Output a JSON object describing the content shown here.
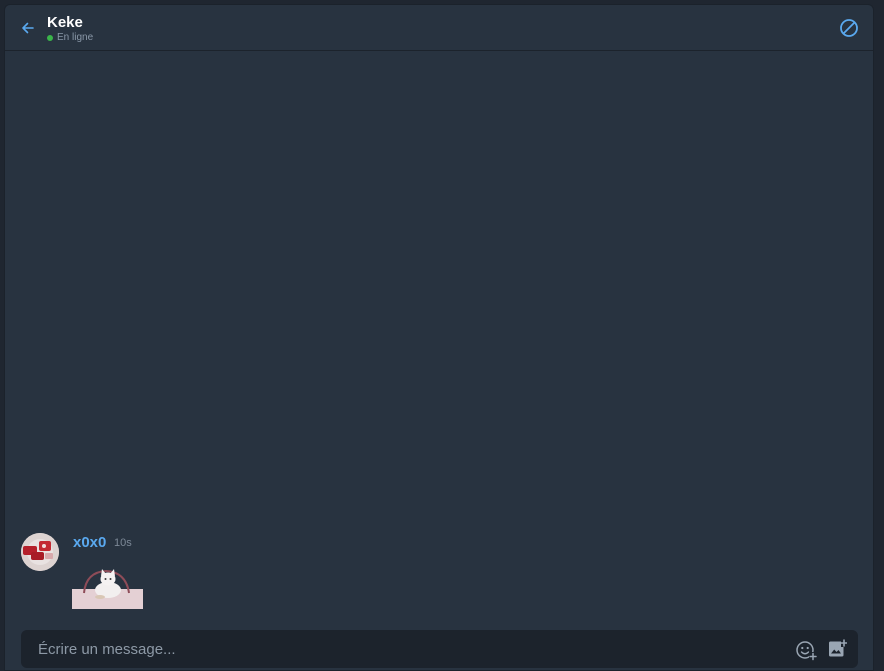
{
  "header": {
    "contact_name": "Keke",
    "status": "En ligne",
    "back_icon": "arrow-left-icon",
    "block_icon": "block-icon"
  },
  "colors": {
    "accent": "#5aa9ef",
    "online": "#3ab54a",
    "background": "#283340",
    "composer_bg": "#1c232c"
  },
  "messages": [
    {
      "author": "x0x0",
      "time": "10s",
      "attachment": "cat-image"
    }
  ],
  "composer": {
    "placeholder": "Écrire un message...",
    "value": "",
    "emoji_icon": "emoji-add-icon",
    "image_icon": "add-photo-icon"
  }
}
